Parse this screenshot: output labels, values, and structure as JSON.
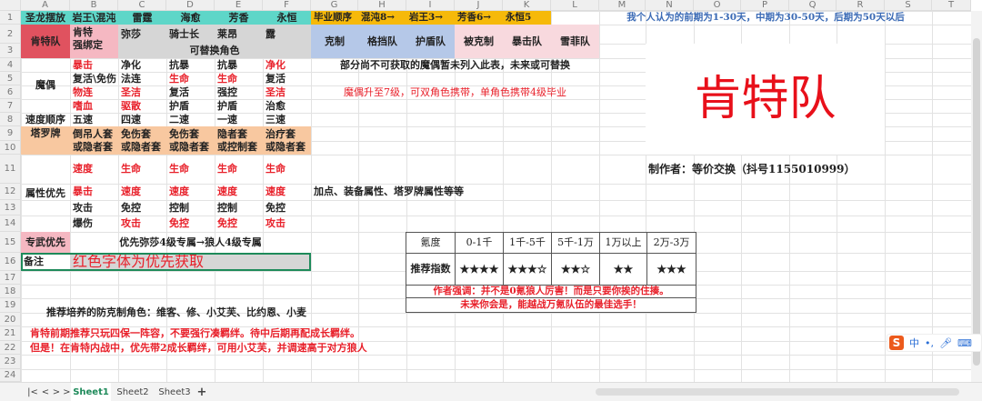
{
  "columns": [
    "A",
    "B",
    "C",
    "D",
    "E",
    "F",
    "G",
    "H",
    "I",
    "J",
    "K",
    "L",
    "M",
    "N",
    "O",
    "P",
    "Q",
    "R",
    "S",
    "T"
  ],
  "rows": [
    "1",
    "2",
    "3",
    "4",
    "5",
    "6",
    "7",
    "8",
    "9",
    "10",
    "11",
    "12",
    "13",
    "14",
    "15",
    "16",
    "17",
    "18",
    "19",
    "20",
    "21",
    "22",
    "23",
    "24"
  ],
  "sheet": {
    "r1": {
      "a": "圣龙摆放",
      "b": "岩王\\混沌",
      "c": "雷霆",
      "d": "海愈",
      "e": "芳香",
      "f": "永恒",
      "g": "毕业顺序",
      "h": "混沌8→",
      "i": "岩王3→",
      "j": "芳香6→",
      "k": "永恒5",
      "m": "我个人认为的前期为1-30天，中期为30-50天，后期为50天以后"
    },
    "team": "肯特队",
    "r2": {
      "b": "肯特\n强绑定",
      "c": "弥莎",
      "d": "骑士长",
      "e": "莱昂",
      "f": "露",
      "g": "克制",
      "h": "格挡队",
      "i": "护盾队",
      "j": "被克制",
      "k": "暴击队",
      "l": "雪菲队"
    },
    "r3": {
      "replaceable": "可替换角色"
    },
    "puppet_label": "魔偶",
    "puppets": [
      [
        "暴击",
        "净化",
        "抗暴",
        "抗暴",
        "净化"
      ],
      [
        "复活\\免伤",
        "法连",
        "生命",
        "生命",
        "复活"
      ],
      [
        "物连",
        "圣洁",
        "复活",
        "强控",
        "圣洁"
      ],
      [
        "嗜血",
        "驱散",
        "护盾",
        "护盾",
        "治愈"
      ]
    ],
    "speed_label": "速度顺序",
    "speed": [
      "五速",
      "四速",
      "二速",
      "一速",
      "三速"
    ],
    "tarot_label": "塔罗牌",
    "tarot": [
      "倒吊人套\n或隐者套",
      "免伤套\n或隐者套",
      "免伤套\n或隐者套",
      "隐者套\n或控制套",
      "治疗套\n或隐者套"
    ],
    "attr_label": "属性优先",
    "attrs": [
      [
        "速度",
        "生命",
        "生命",
        "生命",
        "生命"
      ],
      [
        "暴击",
        "速度",
        "速度",
        "速度",
        "速度"
      ],
      [
        "攻击",
        "免控",
        "控制",
        "控制",
        "免控"
      ],
      [
        "爆伤",
        "攻击",
        "免控",
        "免控",
        "攻击"
      ]
    ],
    "weapon_label": "专武优先",
    "weapon_text": "优先弥莎4级专属→狼人4级专属",
    "note_label": "备注",
    "note_text": "红色字体为优先获取",
    "note_g4": "部分尚不可获取的魔偶暂未列入此表，未来或可替换",
    "note_g6": "魔偶升至7级，可双角色携带，单角色携带4级毕业",
    "note_g12": "加点、装备属性、塔罗牌属性等等",
    "big_title": "肯特队",
    "author": "制作者：等价交换（抖号1155010999）",
    "spend_table": {
      "header": [
        "氪度",
        "0-1千",
        "1千-5千",
        "5千-1万",
        "1万以上",
        "2万-3万"
      ],
      "row": [
        "推荐指数",
        "★★★★",
        "★★★☆",
        "★★☆",
        "★★",
        "★★★"
      ],
      "note1": "作者强调：并不是0氪狼人厉害！而是只要你挨的住揍。",
      "note2": "未来你会是，能越战万氪队伍的最佳选手！"
    },
    "r19": "推荐培养的防克制角色：维客、修、小艾芙、比约恩、小麦",
    "r21": "肯特前期推荐只玩四保一阵容，不要强行凑羁绊。待中后期再配成长羁绊。",
    "r22": "但是！在肯特内战中，优先带2成长羁绊，可用小艾芙，并调速高于对方狼人"
  },
  "tabs": {
    "items": [
      "Sheet1",
      "Sheet2",
      "Sheet3"
    ],
    "add": "+",
    "active": "Sheet1"
  },
  "ime": {
    "lang": "中",
    "logo": "S"
  },
  "colors": {
    "red": "#e8202a",
    "teal": "#5ed6c8",
    "orange": "#f6b90a",
    "active_tab": "#1e8a5a"
  }
}
